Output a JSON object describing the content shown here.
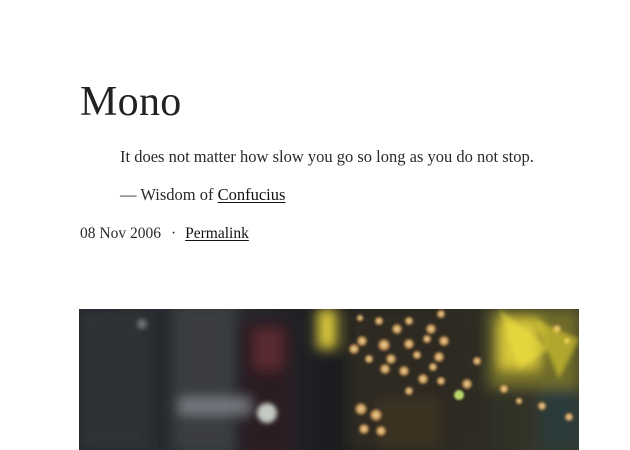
{
  "post": {
    "title": "Mono",
    "quote": {
      "text": "It does not matter how slow you go so long as you do not stop.",
      "attribution_prefix": "— Wisdom of ",
      "author_link": "Confucius"
    },
    "meta": {
      "date": "08 Nov 2006",
      "separator": "·",
      "permalink_label": "Permalink"
    },
    "image": {
      "icon": "bokeh-city-night-photo",
      "accent_colors": [
        "#f2c979",
        "#e8d33a",
        "#1f2329"
      ]
    }
  }
}
